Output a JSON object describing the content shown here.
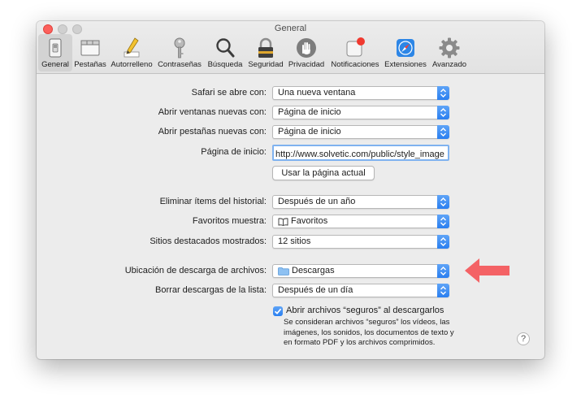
{
  "window": {
    "title": "General"
  },
  "toolbar": {
    "items": [
      {
        "label": "General",
        "icon": "switch-icon",
        "active": true
      },
      {
        "label": "Pestañas",
        "icon": "tabs-icon"
      },
      {
        "label": "Autorrelleno",
        "icon": "pencil-icon"
      },
      {
        "label": "Contraseñas",
        "icon": "key-icon"
      },
      {
        "label": "Búsqueda",
        "icon": "magnifier-icon"
      },
      {
        "label": "Seguridad",
        "icon": "padlock-icon"
      },
      {
        "label": "Privacidad",
        "icon": "hand-icon"
      },
      {
        "label": "Notificaciones",
        "icon": "notification-icon"
      },
      {
        "label": "Extensiones",
        "icon": "compass-icon"
      },
      {
        "label": "Avanzado",
        "icon": "gear-icon"
      }
    ]
  },
  "settings": {
    "safari_opens_with": {
      "label": "Safari se abre con:",
      "value": "Una nueva ventana"
    },
    "new_windows": {
      "label": "Abrir ventanas nuevas con:",
      "value": "Página de inicio"
    },
    "new_tabs": {
      "label": "Abrir pestañas nuevas con:",
      "value": "Página de inicio"
    },
    "homepage": {
      "label": "Página de inicio:",
      "value": "http://www.solvetic.com/public/style_image"
    },
    "use_current_page": "Usar la página actual",
    "remove_history": {
      "label": "Eliminar ítems del historial:",
      "value": "Después de un año"
    },
    "favorites_shows": {
      "label": "Favoritos muestra:",
      "value": "Favoritos"
    },
    "top_sites": {
      "label": "Sitios destacados mostrados:",
      "value": "12 sitios"
    },
    "download_location": {
      "label": "Ubicación de descarga de archivos:",
      "value": "Descargas"
    },
    "remove_downloads": {
      "label": "Borrar descargas de la lista:",
      "value": "Después de un día"
    },
    "open_safe_files": {
      "label": "Abrir archivos “seguros” al descargarlos",
      "checked": true,
      "description_lines": [
        "Se consideran archivos “seguros” los vídeos, las",
        "imágenes, los sonidos, los documentos de texto y",
        "en formato PDF y los archivos comprimidos."
      ]
    },
    "help": "?"
  },
  "colors": {
    "accent": "#2a7ff0",
    "annotation_arrow": "#f46265",
    "close": "#fc605c"
  }
}
